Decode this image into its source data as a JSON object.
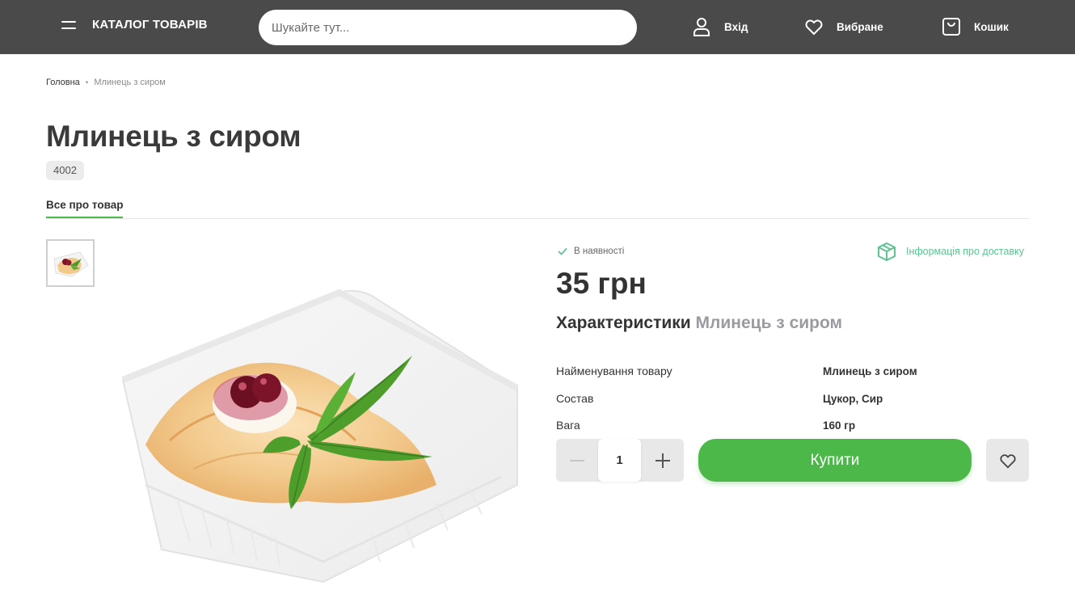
{
  "header": {
    "catalog_label": "КАТАЛОГ ТОВАРІВ",
    "search_placeholder": "Шукайте тут...",
    "login_label": "Вхід",
    "favorites_label": "Вибране",
    "cart_label": "Кошик"
  },
  "breadcrumb": {
    "home": "Головна",
    "separator": "•",
    "current": "Млинець з сиром"
  },
  "product": {
    "title": "Млинець з сиром",
    "sku": "4002",
    "tab_label": "Все про товар",
    "stock_status": "В наявності",
    "delivery_info": "Інформація про доставку",
    "price": "35 грн",
    "characteristics_title": "Характеристики",
    "characteristics_subject": "Млинець з сиром",
    "specs": [
      {
        "label": "Найменування товару",
        "value": "Млинець з сиром"
      },
      {
        "label": "Состав",
        "value": "Цукор, Сир"
      },
      {
        "label": "Вага",
        "value": "160 гр"
      }
    ],
    "quantity": "1",
    "buy_label": "Купити"
  },
  "colors": {
    "header_bg": "#4a4a4a",
    "accent_green": "#4cb84a",
    "delivery_teal": "#5cc391"
  }
}
